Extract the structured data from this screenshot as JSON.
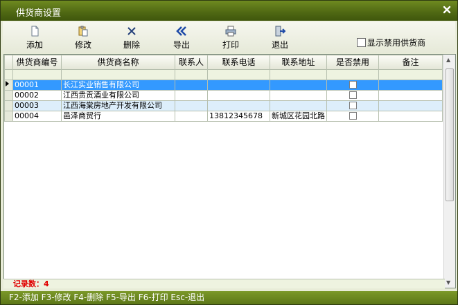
{
  "window": {
    "title": "供货商设置"
  },
  "toolbar": [
    {
      "label": "添加",
      "icon": "document-icon"
    },
    {
      "label": "修改",
      "icon": "paste-icon"
    },
    {
      "label": "删除",
      "icon": "delete-x-icon"
    },
    {
      "label": "导出",
      "icon": "double-chevron-left-icon"
    },
    {
      "label": "打印",
      "icon": "printer-icon"
    },
    {
      "label": "退出",
      "icon": "exit-door-icon"
    }
  ],
  "show_disabled_label": "显示禁用供货商",
  "grid": {
    "columns": [
      "供货商编号",
      "供货商名称",
      "联系人",
      "联系电话",
      "联系地址",
      "是否禁用",
      "备注"
    ],
    "rows": [
      {
        "id": "00001",
        "name": "长江实业销售有限公司",
        "contact": "",
        "phone": "",
        "address": "",
        "disabled": false,
        "note": ""
      },
      {
        "id": "00002",
        "name": "江西贵贡酒业有限公司",
        "contact": "",
        "phone": "",
        "address": "",
        "disabled": false,
        "note": ""
      },
      {
        "id": "00003",
        "name": "江西海棠房地产开发有限公司",
        "contact": "",
        "phone": "",
        "address": "",
        "disabled": false,
        "note": ""
      },
      {
        "id": "00004",
        "name": "邑泽商贸行",
        "contact": "",
        "phone": "13812345678",
        "address": "新城区花园北路",
        "disabled": false,
        "note": ""
      }
    ]
  },
  "record_count_label": "记录数：4",
  "status_bar": "F2-添加 F3-修改 F4-删除 F5-导出 F6-打印 Esc-退出",
  "colors": {
    "title_bar": "#5a7318",
    "selected_row": "#3399ff",
    "alt_row": "#ddeefb",
    "filter_row": "#eef3e0",
    "record_count": "#e00000"
  }
}
